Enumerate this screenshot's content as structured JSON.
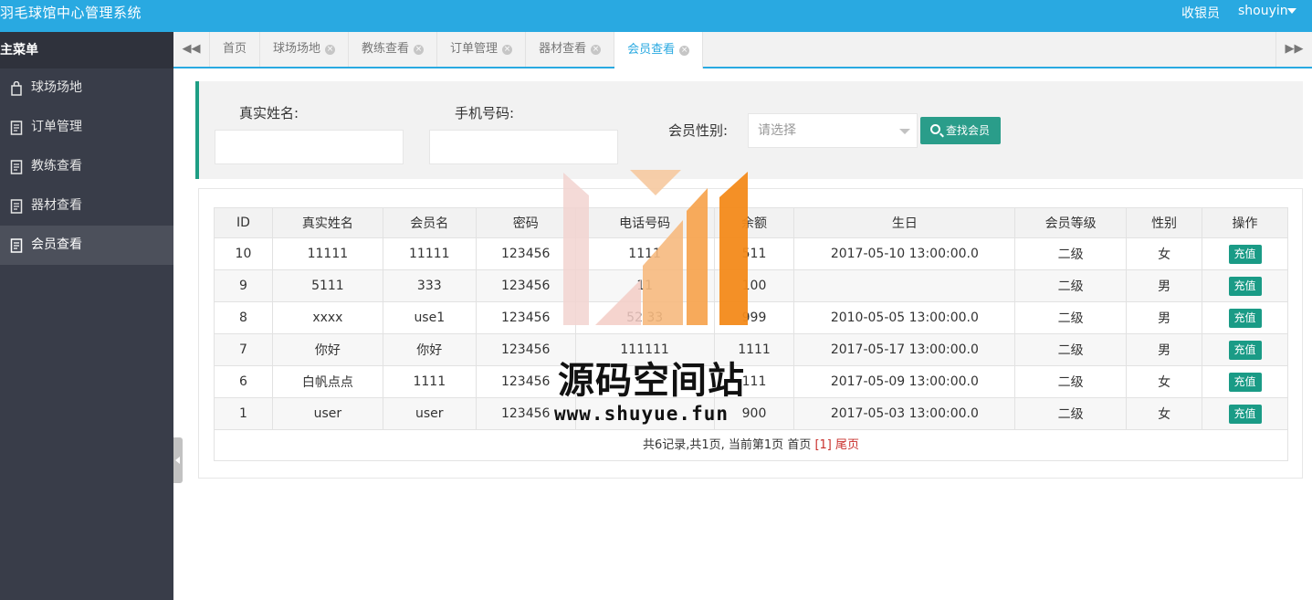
{
  "header": {
    "app_title": "羽毛球馆中心管理系统",
    "role": "收银员",
    "username": "shouyin"
  },
  "sidebar": {
    "heading": "主菜单",
    "items": [
      {
        "label": "球场场地",
        "icon": "shopping-bag-icon",
        "active": false
      },
      {
        "label": "订单管理",
        "icon": "document-icon",
        "active": false
      },
      {
        "label": "教练查看",
        "icon": "document-icon",
        "active": false
      },
      {
        "label": "器材查看",
        "icon": "document-icon",
        "active": false
      },
      {
        "label": "会员查看",
        "icon": "document-icon",
        "active": true
      }
    ]
  },
  "tabs": {
    "prev_icon": "double-left-arrow-icon",
    "next_icon": "double-right-arrow-icon",
    "items": [
      {
        "label": "首页",
        "closable": false,
        "active": false
      },
      {
        "label": "球场场地",
        "closable": true,
        "active": false
      },
      {
        "label": "教练查看",
        "closable": true,
        "active": false
      },
      {
        "label": "订单管理",
        "closable": true,
        "active": false
      },
      {
        "label": "器材查看",
        "closable": true,
        "active": false
      },
      {
        "label": "会员查看",
        "closable": true,
        "active": true
      }
    ],
    "close_glyph": "×"
  },
  "search": {
    "realname_label": "真实姓名:",
    "realname_value": "",
    "phone_label": "手机号码:",
    "phone_value": "",
    "gender_label": "会员性别:",
    "gender_placeholder": "请选择",
    "search_button": "查找会员"
  },
  "table": {
    "columns": [
      "ID",
      "真实姓名",
      "会员名",
      "密码",
      "电话号码",
      "余额",
      "生日",
      "会员等级",
      "性别",
      "操作"
    ],
    "action_label": "充值",
    "rows": [
      {
        "id": "10",
        "realname": "11111",
        "membername": "11111",
        "password": "123456",
        "phone": "1111",
        "balance": "511",
        "birthday": "2017-05-10 13:00:00.0",
        "level": "二级",
        "gender": "女"
      },
      {
        "id": "9",
        "realname": "5111",
        "membername": "333",
        "password": "123456",
        "phone": "11",
        "balance": "100",
        "birthday": "",
        "level": "二级",
        "gender": "男"
      },
      {
        "id": "8",
        "realname": "xxxx",
        "membername": "use1",
        "password": "123456",
        "phone": "52 33",
        "balance": "999",
        "birthday": "2010-05-05 13:00:00.0",
        "level": "二级",
        "gender": "男"
      },
      {
        "id": "7",
        "realname": "你好",
        "membername": "你好",
        "password": "123456",
        "phone": "111111",
        "balance": "1111",
        "birthday": "2017-05-17 13:00:00.0",
        "level": "二级",
        "gender": "男"
      },
      {
        "id": "6",
        "realname": "白帆点点",
        "membername": "1111",
        "password": "123456",
        "phone": "",
        "balance": "111",
        "birthday": "2017-05-09 13:00:00.0",
        "level": "二级",
        "gender": "女"
      },
      {
        "id": "1",
        "realname": "user",
        "membername": "user",
        "password": "123456",
        "phone": "",
        "balance": "900",
        "birthday": "2017-05-03 13:00:00.0",
        "level": "二级",
        "gender": "女"
      }
    ],
    "pager": {
      "summary": "共6记录,共1页, 当前第1页",
      "first": "首页",
      "current": "[1]",
      "last": "尾页"
    }
  },
  "watermark": {
    "name": "源码空间站",
    "url": "www.shuyue.fun"
  },
  "colors": {
    "header_bg": "#29a9e1",
    "sidebar_bg": "#393d49",
    "accent_green": "#1a9b86",
    "pager_current": "#c9302c"
  }
}
